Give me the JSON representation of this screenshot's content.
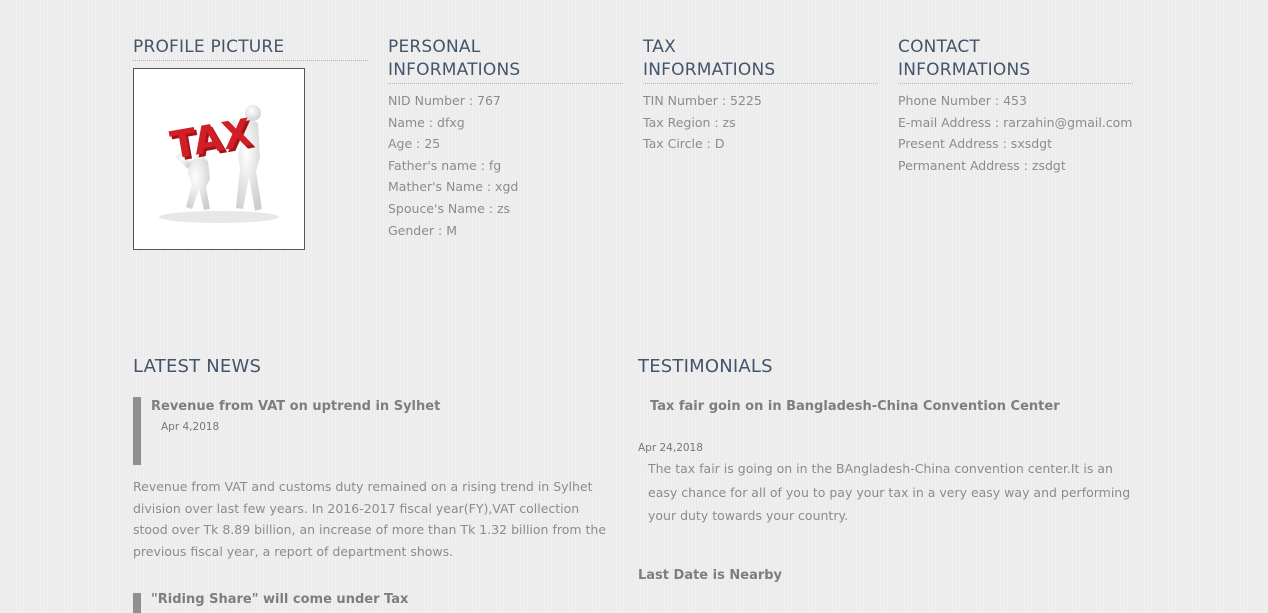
{
  "profile": {
    "title": "PROFILE PICTURE",
    "image_text": "TAX"
  },
  "personal": {
    "title_line1": "PERSONAL",
    "title_line2": "INFORMATIONS",
    "items": [
      "NID Number : 767",
      "Name : dfxg",
      "Age : 25",
      "Father's name : fg",
      "Mather's Name : xgd",
      "Spouce's Name : zs",
      "Gender : M"
    ]
  },
  "tax": {
    "title_line1": "TAX",
    "title_line2": "INFORMATIONS",
    "items": [
      "TIN Number : 5225",
      "Tax Region : zs",
      "Tax Circle : D"
    ]
  },
  "contact": {
    "title_line1": "CONTACT",
    "title_line2": "INFORMATIONS",
    "items": [
      "Phone Number : 453",
      "E-mail Address : rarzahin@gmail.com",
      "Present Address : sxsdgt",
      "Permanent Address : zsdgt"
    ]
  },
  "news": {
    "title": "LATEST NEWS",
    "items": [
      {
        "headline": "Revenue from VAT on uptrend in Sylhet",
        "date": "Apr 4,2018",
        "body": "Revenue from VAT and customs duty remained on a rising trend in Sylhet division over last few years. In 2016-2017 fiscal year(FY),VAT collection stood over Tk 8.89 billion, an increase of more than Tk 1.32 billion from the previous fiscal year, a report of department shows."
      },
      {
        "headline": "\"Riding Share\" will come under Tax"
      }
    ]
  },
  "testimonials": {
    "title": "TESTIMONIALS",
    "items": [
      {
        "headline": "Tax fair goin on in Bangladesh-China Convention Center",
        "date": "Apr 24,2018",
        "body": "The tax fair is going on in the BAngladesh-China convention center.It is an easy chance for all of you to pay your tax in a very easy way and performing your duty towards your country."
      },
      {
        "headline": "Last Date is Nearby"
      }
    ]
  },
  "colors": {
    "heading": "#44546a",
    "text": "#8c8c8c",
    "tax_red": "#d21f26"
  }
}
